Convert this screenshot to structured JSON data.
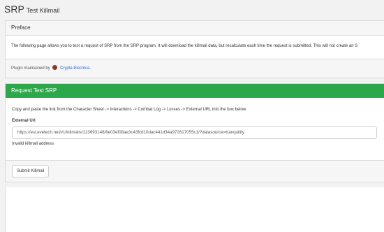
{
  "header": {
    "app_name": "SRP",
    "page_title": "Test Killmail"
  },
  "preface": {
    "title": "Preface",
    "body": "The following page allows you to test a request of SRP from the SRP program. It will download the killmail data, but recalculate each time the request is submitted. This will not create an S",
    "footer_prefix": "Plugin maintained by",
    "maintainer_link": "Crypta Electrica."
  },
  "request": {
    "title": "Request Test SRP",
    "instructions": "Copy and paste the link from the Character Sheet -> Interactions -> Combat Log -> Losses -> External URL into the box below.",
    "field_label": "External Url",
    "field_value": "https://esi.evetech.net/v1/killmails/123693148/8e03ef08ae3c43fcd10dac441d34a972617055c1/?datasource=tranquility",
    "error": "Invalid killmail address",
    "submit_label": "Submit Killmail"
  },
  "colors": {
    "accent_green": "#2ca84a",
    "link_blue": "#2e6bd6"
  }
}
